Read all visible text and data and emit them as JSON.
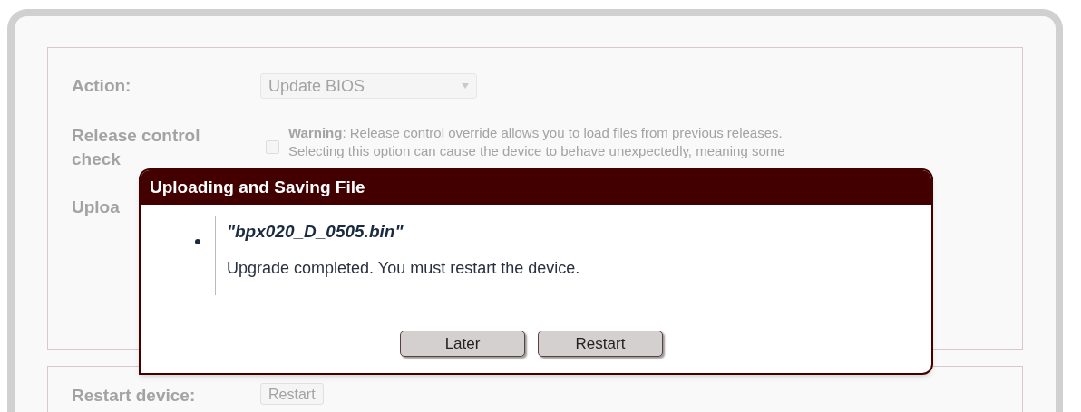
{
  "form": {
    "disabled": true,
    "action": {
      "label": "Action:",
      "value": "Update BIOS"
    },
    "release": {
      "label_lines": [
        "Release control",
        "check"
      ],
      "checked": false,
      "warning_lines": [
        "**Warning**: Release control override allows you to load files from previous releases.",
        "Selecting this option can cause the device to behave unexpectedly, meaning some"
      ]
    },
    "upload": {
      "label": "Uploa"
    },
    "restart": {
      "label": "Restart device:",
      "button": "Restart"
    }
  },
  "dialog": {
    "title": "Uploading and Saving File",
    "items": [
      {
        "file": "\"bpx020_D_0505.bin\"",
        "message": "Upgrade completed. You must restart the device."
      }
    ],
    "buttons": [
      "Later",
      "Restart"
    ]
  }
}
